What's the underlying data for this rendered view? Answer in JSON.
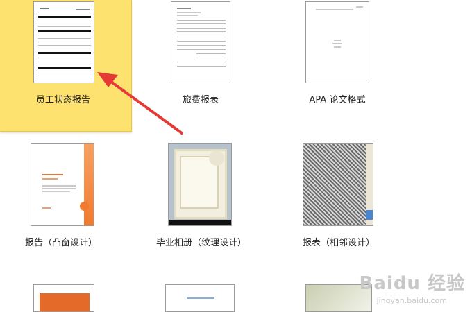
{
  "templates": [
    {
      "label": "员工状态报告",
      "selected": true
    },
    {
      "label": "旅费报表",
      "selected": false
    },
    {
      "label": "APA 论文格式",
      "selected": false
    },
    {
      "label": "报告（凸窗设计）",
      "selected": false
    },
    {
      "label": "毕业相册（纹理设计）",
      "selected": false
    },
    {
      "label": "报表（相邻设计）",
      "selected": false
    }
  ],
  "watermark": {
    "brand": "Baidu 经验",
    "url": "jingyan.baidu.com"
  },
  "colors": {
    "selected_bg": "#fde26f",
    "arrow": "#e53935",
    "accent_orange": "#f07a2e"
  }
}
